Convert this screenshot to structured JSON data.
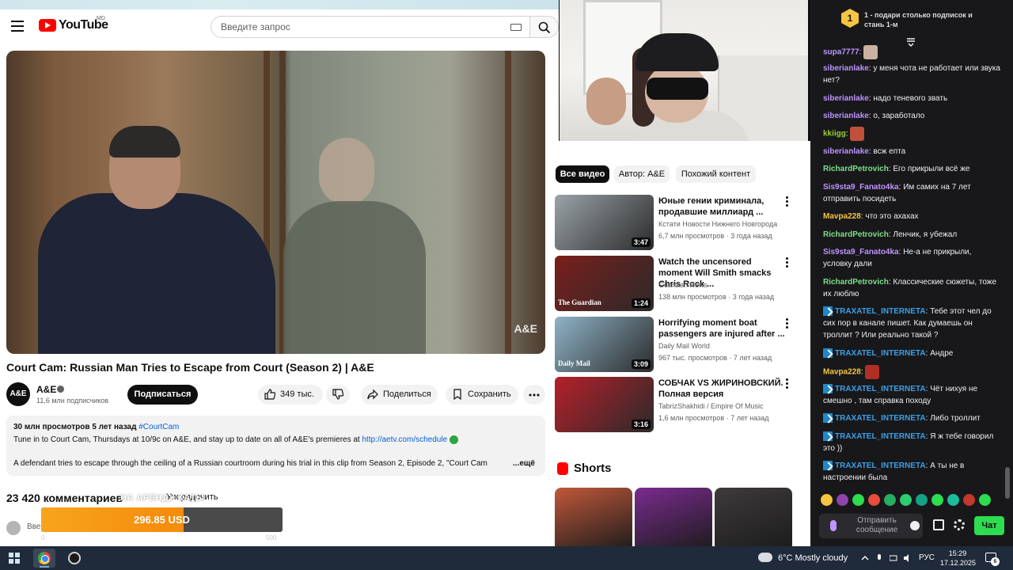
{
  "youtube": {
    "logo_text": "YouTube",
    "logo_region": "MD",
    "search_placeholder": "Введите запрос",
    "video": {
      "title": "Court Cam: Russian Man Tries to Escape from Court (Season 2) | A&E",
      "watermark": "A&E",
      "channel": "A&E",
      "channel_avatar": "A&E",
      "subscribers": "11,6 млн подписчиков",
      "subscribe_label": "Подписаться",
      "likes": "349 тыс.",
      "share_label": "Поделиться",
      "save_label": "Сохранить"
    },
    "description": {
      "stats": "30 млн просмотров  5 лет назад",
      "hashtag": "#CourtCam",
      "line1_text": "Tune in to Court Cam, Thursdays at 10/9c on A&E, and stay up to date on all of A&E's premieres at ",
      "line1_link": "http://aetv.com/schedule",
      "line2": "A defendant tries to escape through the ceiling of a Russian courtroom during his trial in this clip from Season 2, Episode 2, \"Court Cam",
      "more": "...ещё"
    },
    "comments": {
      "count": "23 420 комментариев",
      "sort_label": "Упорядочить",
      "input_placeholder": "Вве"
    },
    "related": {
      "chips": [
        "Все видео",
        "Автор: A&E",
        "Похожий контент"
      ],
      "items": [
        {
          "title": "Юные гении криминала, продавшие миллиард ...",
          "channel": "Кстати Новости Нижнего Новгорода",
          "meta": "6,7 млн просмотров · 3 года назад",
          "duration": "3:47",
          "thumb_color": "#9aa3a8"
        },
        {
          "title": "Watch the uncensored moment Will Smith smacks Chris Rock ...",
          "channel": "Guardian News",
          "meta": "138 млн просмотров · 3 года назад",
          "duration": "1:24",
          "thumb_color": "#7a1f1c",
          "thumb_text": "The Guardian"
        },
        {
          "title": "Horrifying moment boat passengers are injured after ...",
          "channel": "Daily Mail World",
          "meta": "967 тыс. просмотров · 7 лет назад",
          "duration": "3:09",
          "thumb_color": "#8fb3c7",
          "thumb_text": "Daily Mail"
        },
        {
          "title": "СОБЧАК VS ЖИРИНОВСКИЙ. Полная версия",
          "channel": "TabrizShakhidi / Empire Of Music",
          "meta": "1,6 млн просмотров · 7 лет назад",
          "duration": "3:16",
          "thumb_color": "#b5202a"
        }
      ],
      "shorts_title": "Shorts",
      "shorts_colors": [
        "#c0583a",
        "#7a2b8f",
        "#3e3a3c"
      ]
    }
  },
  "donation_widget": {
    "label": "НА АРЕНДУ ХАТЫ",
    "amount": "296.85 USD",
    "min": "0",
    "max": "500",
    "progress": 0.59
  },
  "chat": {
    "goal_badge": "1",
    "goal_text": "1 - подари столько подписок и стань 1-м",
    "messages": [
      {
        "user": "supa7777",
        "text": "",
        "color": "#bf94ff",
        "emote": "#c9b1a3",
        "badge": false
      },
      {
        "user": "siberianlake",
        "text": "у меня чота не работает или звука нет?",
        "color": "#bf94ff",
        "badge": false
      },
      {
        "user": "siberianlake",
        "text": "надо теневого звать",
        "color": "#bf94ff",
        "badge": false
      },
      {
        "user": "siberianlake",
        "text": "о, заработало",
        "color": "#bf94ff",
        "badge": false
      },
      {
        "user": "kkiigg",
        "text": "",
        "color": "#9acd32",
        "emote": "#c0503a",
        "badge": false
      },
      {
        "user": "siberianlake",
        "text": "всж епта",
        "color": "#bf94ff",
        "badge": false
      },
      {
        "user": "RichardPetrovich",
        "text": "Его прикрыли всё же",
        "color": "#7ee08a",
        "badge": false
      },
      {
        "user": "Sis9sta9_Fanato4ka",
        "text": "Им самих на 7 лет отправить посидеть",
        "color": "#bf94ff",
        "badge": false
      },
      {
        "user": "Mavpa228",
        "text": "что это ахахах",
        "color": "#f5c542",
        "badge": false
      },
      {
        "user": "RichardPetrovich",
        "text": "Ленчик, я убежал",
        "color": "#7ee08a",
        "badge": false
      },
      {
        "user": "Sis9sta9_Fanato4ka",
        "text": "Не-а не прикрыли, условку дали",
        "color": "#bf94ff",
        "badge": false
      },
      {
        "user": "RichardPetrovich",
        "text": "Классические сюжеты, тоже их люблю",
        "color": "#7ee08a",
        "badge": false
      },
      {
        "user": "TRAXATEL_INTERNETA",
        "text": "Тебе этот чел до сих пор в канале пишет. Как думаешь он троллит ? Или реально такой ?",
        "color": "#3ba0e8",
        "badge": true
      },
      {
        "user": "TRAXATEL_INTERNETA",
        "text": "Андре",
        "color": "#3ba0e8",
        "badge": true
      },
      {
        "user": "Mavpa228",
        "text": "",
        "color": "#f5c542",
        "emote": "#b02f24",
        "badge": false
      },
      {
        "user": "TRAXATEL_INTERNETA",
        "text": "Чёт нихуя не смешно , там справка походу",
        "color": "#3ba0e8",
        "badge": true
      },
      {
        "user": "TRAXATEL_INTERNETA",
        "text": "Либо троллит",
        "color": "#3ba0e8",
        "badge": true
      },
      {
        "user": "TRAXATEL_INTERNETA",
        "text": "Я ж тебе говорил это ))",
        "color": "#3ba0e8",
        "badge": true
      },
      {
        "user": "TRAXATEL_INTERNETA",
        "text": "А ты не в настроении была",
        "color": "#3ba0e8",
        "badge": true
      }
    ],
    "emote_bar_colors": [
      "#f5c542",
      "#8e44ad",
      "#2edc4f",
      "#e74c3c",
      "#27ae60",
      "#2ecc71",
      "#16a085",
      "#2edc4f",
      "#1abc9c",
      "#c0392b",
      "#2edc4f"
    ],
    "input_placeholder": "Отправить сообщение",
    "chat_button": "Чат"
  },
  "taskbar": {
    "weather_text": "6°C  Mostly cloudy",
    "language": "РУС",
    "time": "15:29",
    "date": "17.12.2025",
    "notifications": "6"
  }
}
